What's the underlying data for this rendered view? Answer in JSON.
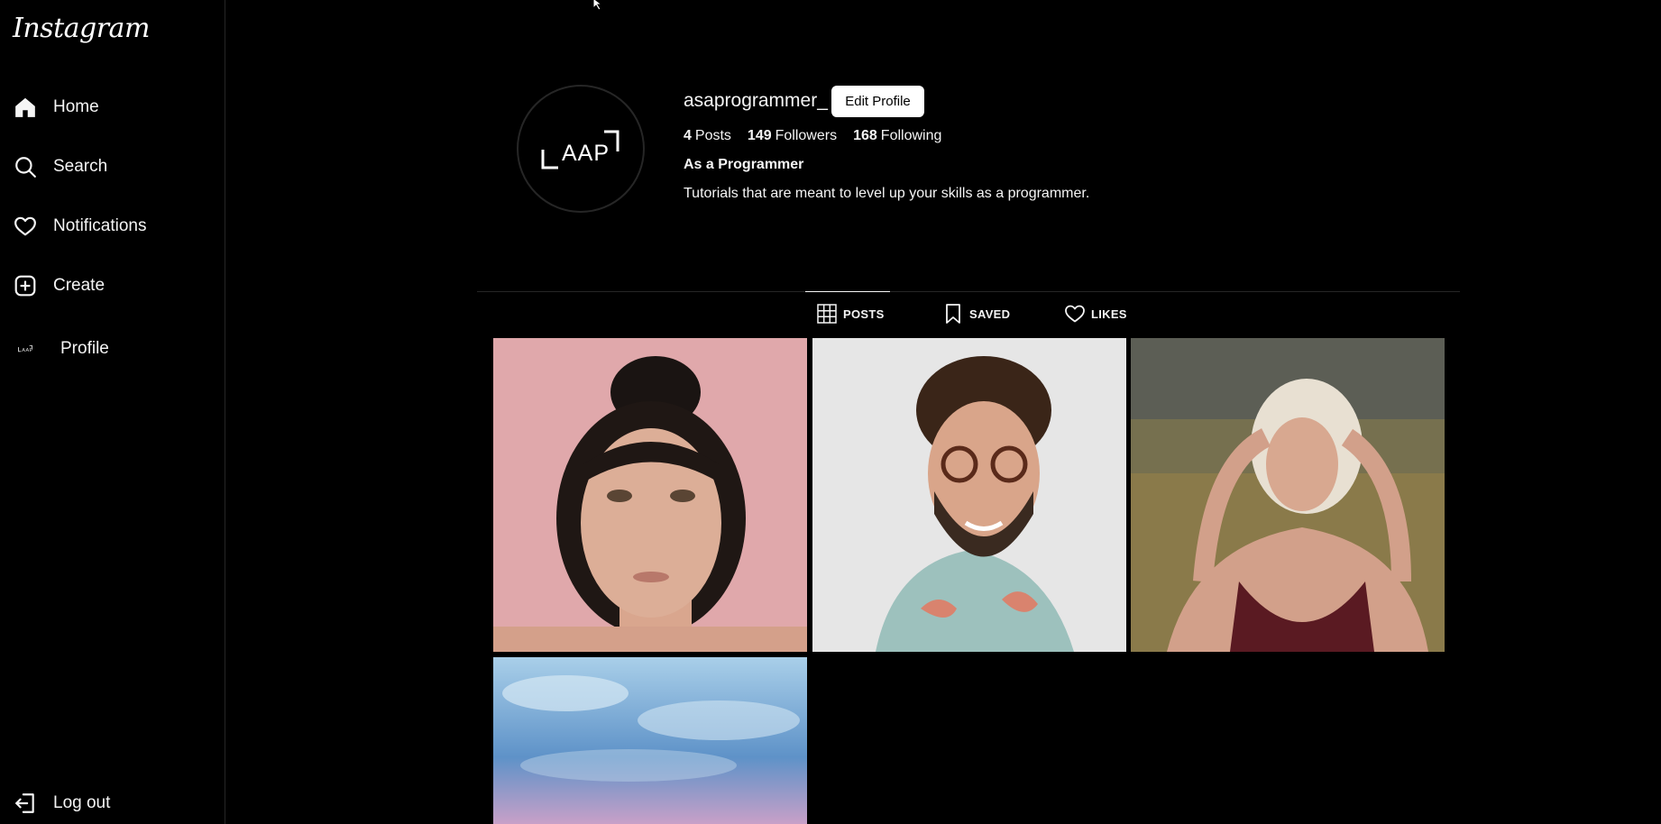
{
  "sidebar": {
    "logo": "Instagram",
    "items": [
      {
        "label": "Home",
        "icon": "home-icon"
      },
      {
        "label": "Search",
        "icon": "search-icon"
      },
      {
        "label": "Notifications",
        "icon": "heart-icon"
      },
      {
        "label": "Create",
        "icon": "plus-square-icon"
      },
      {
        "label": "Profile",
        "icon": "profile-avatar"
      }
    ],
    "logout": {
      "label": "Log out",
      "icon": "logout-icon"
    }
  },
  "profile": {
    "username": "asaprogrammer_",
    "edit_button": "Edit Profile",
    "stats": {
      "posts_count": "4",
      "posts_label": "Posts",
      "followers_count": "149",
      "followers_label": "Followers",
      "following_count": "168",
      "following_label": "Following"
    },
    "full_name": "As a Programmer",
    "bio": "Tutorials that are meant to level up your skills as a programmer.",
    "avatar_text": "AAP"
  },
  "tabs": [
    {
      "label": "POSTS",
      "icon": "grid-icon",
      "active": true
    },
    {
      "label": "SAVED",
      "icon": "bookmark-icon",
      "active": false
    },
    {
      "label": "LIKES",
      "icon": "heart-icon",
      "active": false
    }
  ],
  "posts": [
    {
      "subject": "woman-portrait-pink-background"
    },
    {
      "subject": "man-glasses-floral-shirt"
    },
    {
      "subject": "blonde-woman-field"
    },
    {
      "subject": "sky-clouds"
    }
  ],
  "colors": {
    "background": "#000000",
    "text": "#f5f5f5",
    "divider": "#262626",
    "button_bg": "#ffffff"
  }
}
